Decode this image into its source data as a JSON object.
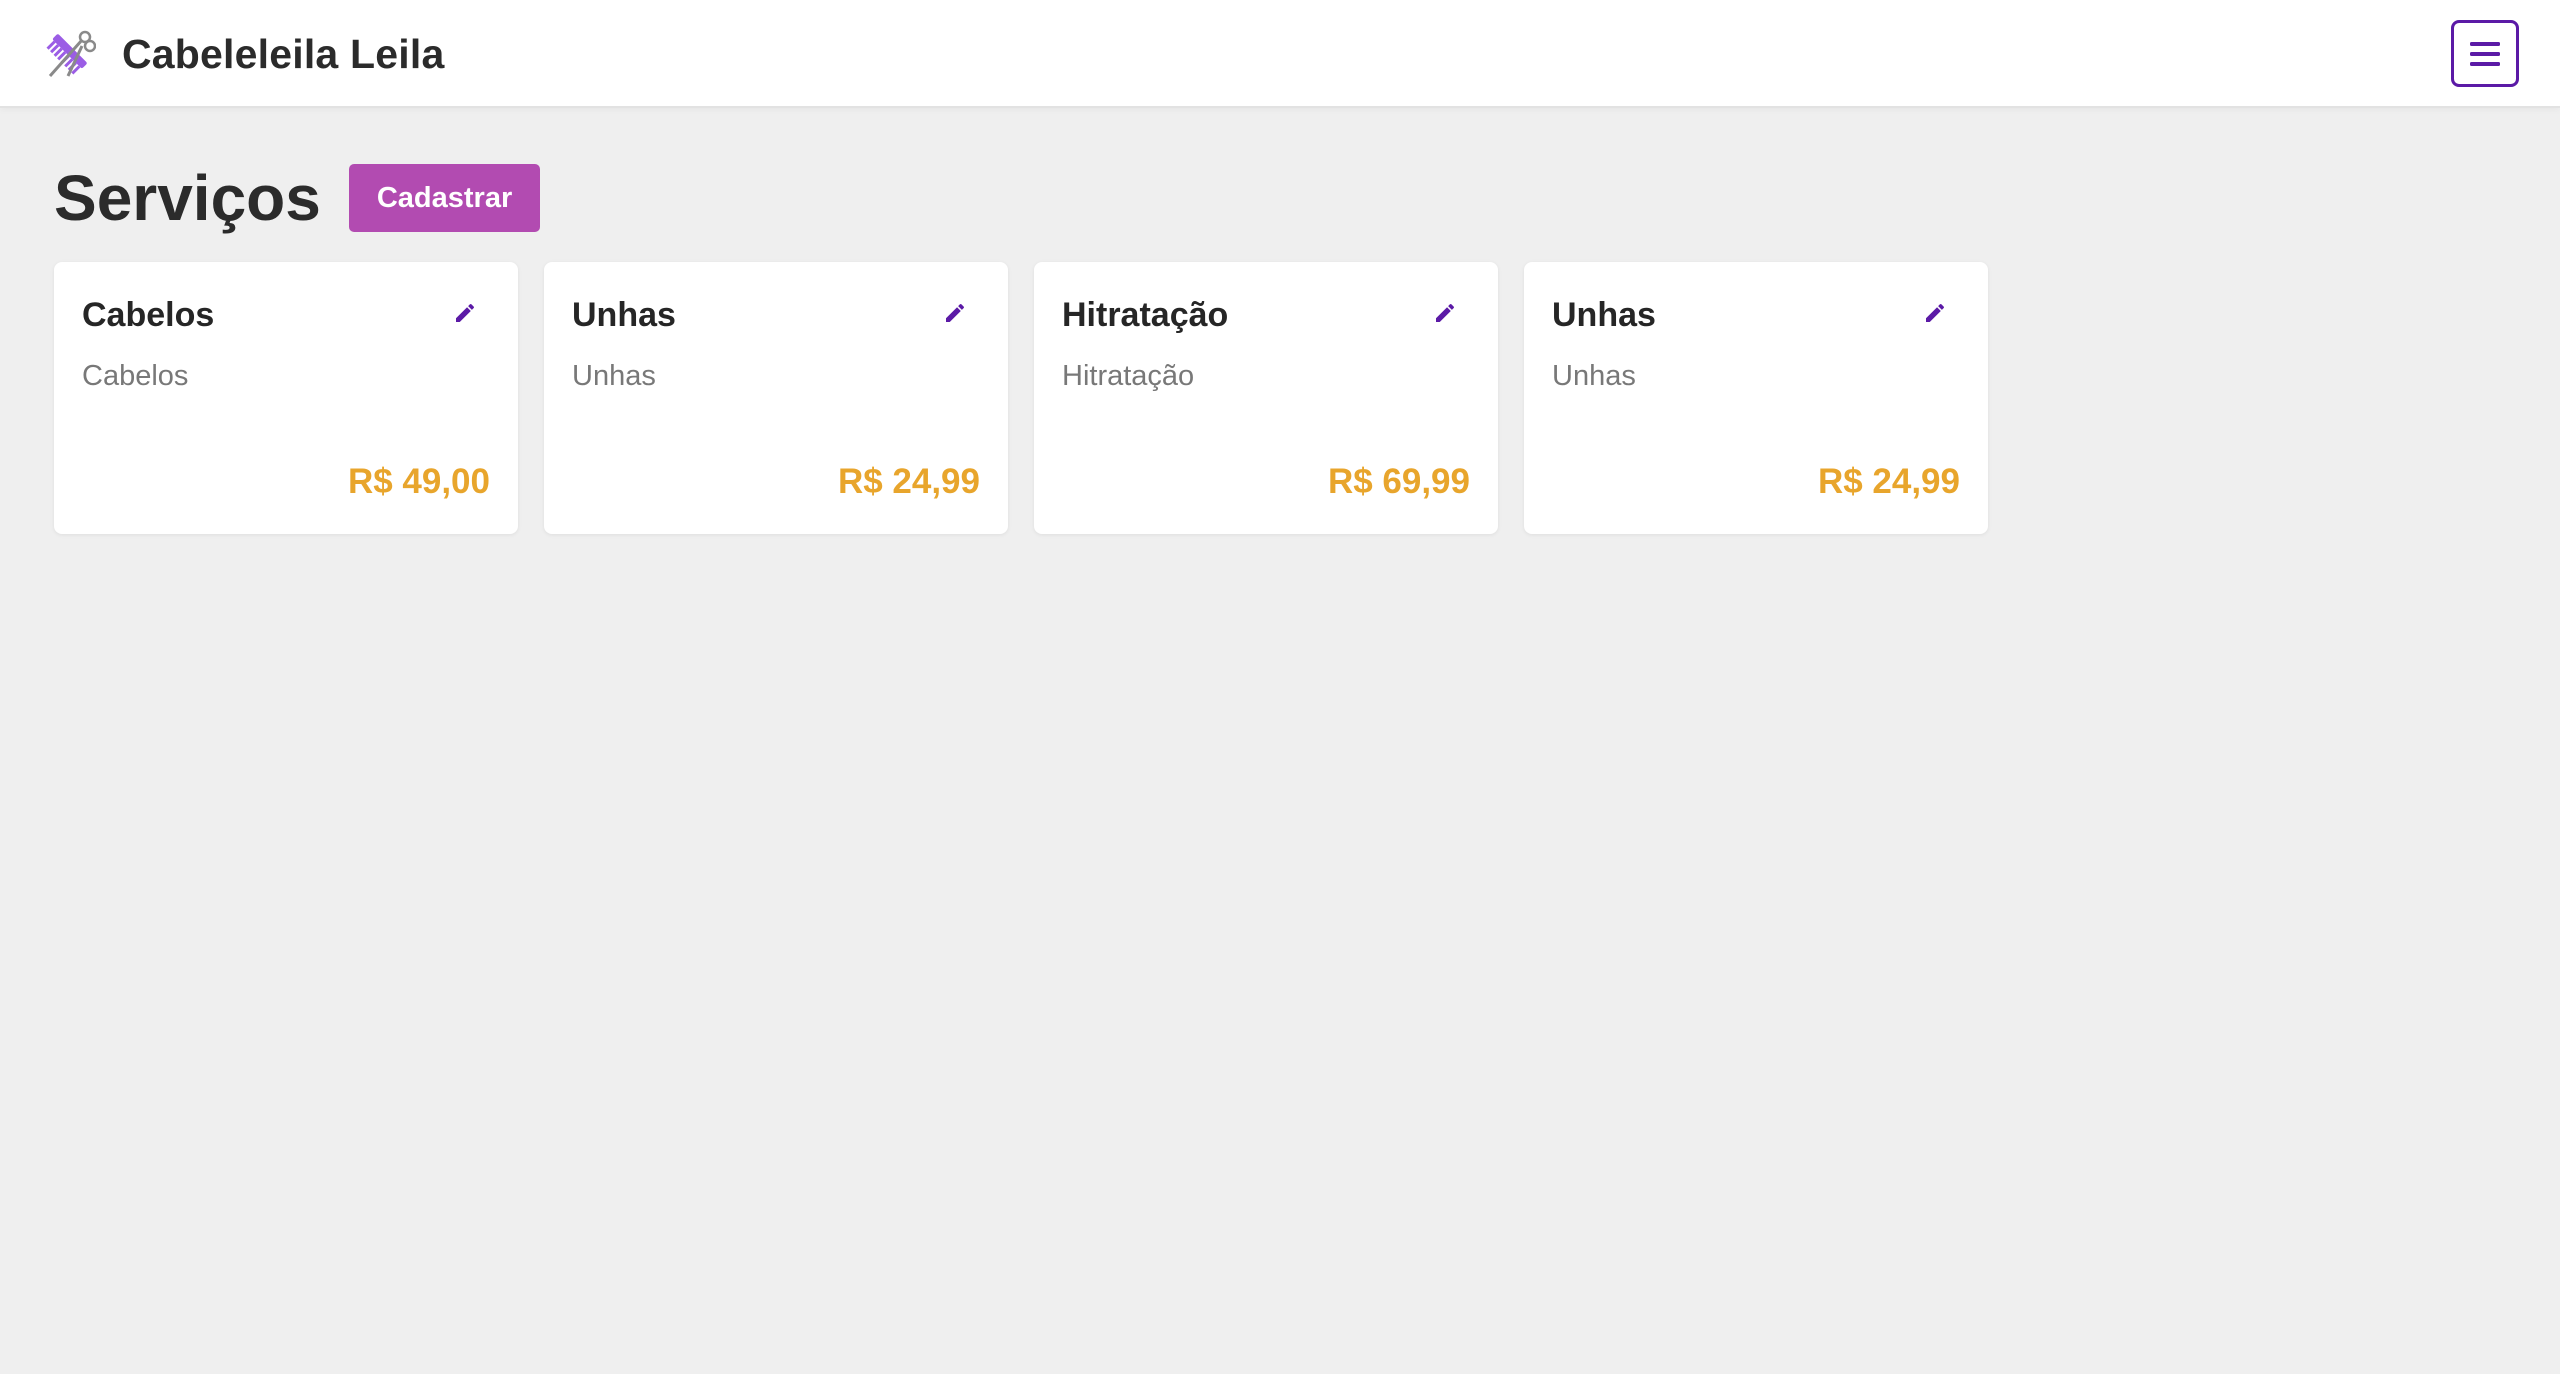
{
  "navbar": {
    "brand_name": "Cabeleleila Leila",
    "logo_icon": "comb-scissors-icon",
    "menu_icon": "hamburger-menu-icon"
  },
  "page": {
    "title": "Serviços",
    "register_label": "Cadastrar"
  },
  "services": [
    {
      "title": "Cabelos",
      "description": "Cabelos",
      "price": "R$ 49,00"
    },
    {
      "title": "Unhas",
      "description": "Unhas",
      "price": "R$ 24,99"
    },
    {
      "title": "Hitratação",
      "description": "Hitratação",
      "price": "R$ 69,99"
    },
    {
      "title": "Unhas",
      "description": "Unhas",
      "price": "R$ 24,99"
    }
  ],
  "colors": {
    "accent_purple": "#5b1aa6",
    "button_magenta": "#b24bb1",
    "price_orange": "#e8a52c",
    "background": "#efefef"
  }
}
